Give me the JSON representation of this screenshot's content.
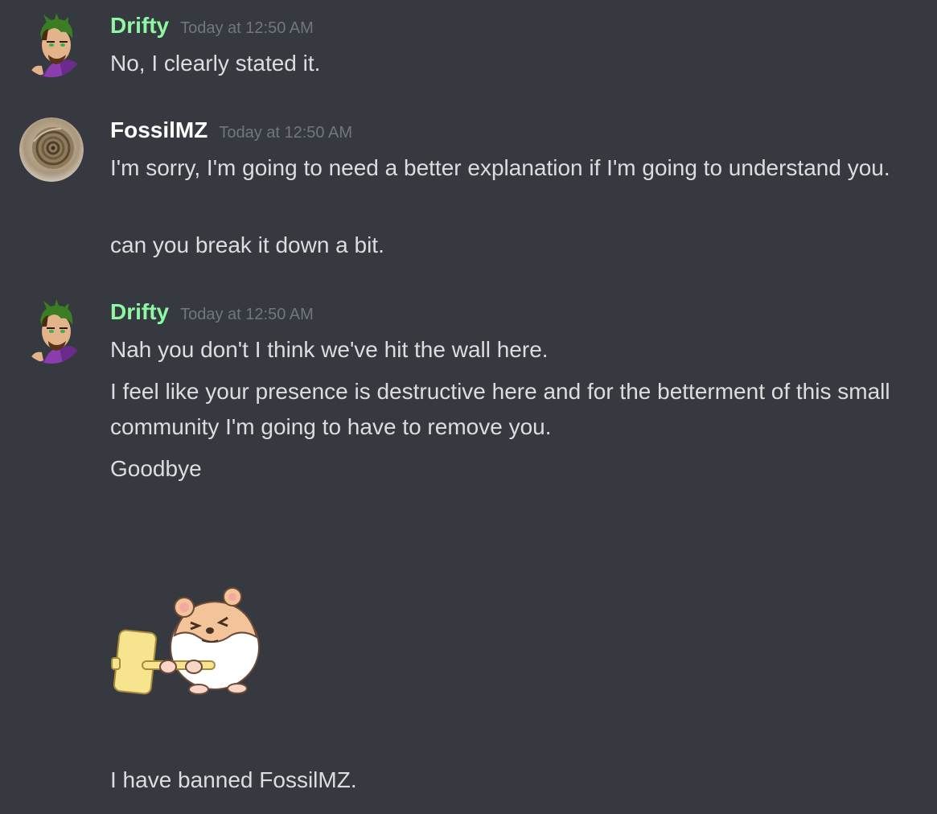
{
  "colors": {
    "background": "#36393f",
    "drifty": "#8ef7a2",
    "fossil": "#ffffff",
    "timestamp": "#72767d",
    "text": "#dcddde"
  },
  "messages": [
    {
      "author": "Drifty",
      "timestamp": "Today at 12:50 AM",
      "lines": [
        "No, I clearly stated it."
      ]
    },
    {
      "author": "FossilMZ",
      "timestamp": "Today at 12:50 AM",
      "lines": [
        "I'm sorry, I'm going to need a better explanation if I'm going to understand you.",
        "can you break it down a bit."
      ]
    },
    {
      "author": "Drifty",
      "timestamp": "Today at 12:50 AM",
      "lines": [
        "Nah you don't I think we've hit the wall here.",
        "I feel like your presence is destructive here and for the betterment of this small community I'm going to have to remove you.",
        "Goodbye"
      ],
      "sticker": "hamster-with-ban-hammer",
      "after_sticker": "I have banned FossilMZ."
    }
  ]
}
